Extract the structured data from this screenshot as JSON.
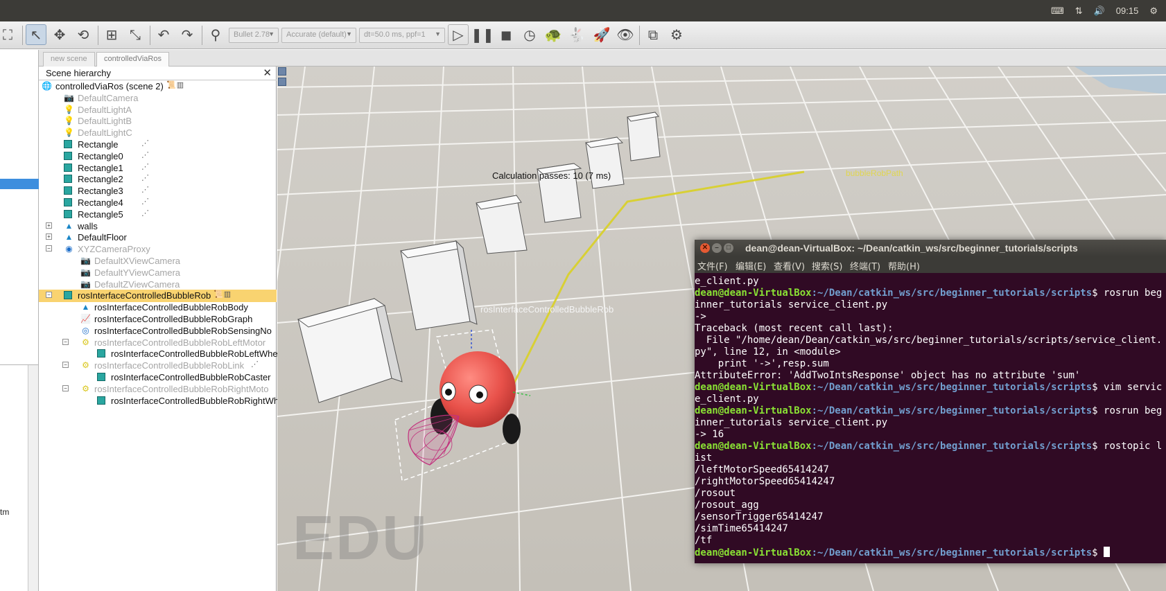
{
  "system_tray": {
    "keyboard_icon": "keyboard-icon",
    "network_icon": "network-arrows-icon",
    "volume_icon": "volume-icon",
    "time": "09:15",
    "gear_icon": "gear-icon"
  },
  "toolbar": {
    "engine": "Bullet 2.78",
    "accuracy": "Accurate (default)",
    "timestep": "dt=50.0 ms, ppf=1"
  },
  "scene_tabs": [
    "new scene",
    "controlledViaRos"
  ],
  "hierarchy": {
    "title": "Scene hierarchy",
    "root": "controlledViaRos (scene 2)",
    "items": [
      {
        "label": "DefaultCamera",
        "icon": "camera-icon",
        "dim": true
      },
      {
        "label": "DefaultLightA",
        "icon": "light-icon",
        "dim": true
      },
      {
        "label": "DefaultLightB",
        "icon": "light-icon",
        "dim": true
      },
      {
        "label": "DefaultLightC",
        "icon": "light-icon",
        "dim": true
      },
      {
        "label": "Rectangle",
        "icon": "cuboid-icon",
        "dim": false
      },
      {
        "label": "Rectangle0",
        "icon": "cuboid-icon",
        "dim": false
      },
      {
        "label": "Rectangle1",
        "icon": "cuboid-icon",
        "dim": false
      },
      {
        "label": "Rectangle2",
        "icon": "cuboid-icon",
        "dim": false
      },
      {
        "label": "Rectangle3",
        "icon": "cuboid-icon",
        "dim": false
      },
      {
        "label": "Rectangle4",
        "icon": "cuboid-icon",
        "dim": false
      },
      {
        "label": "Rectangle5",
        "icon": "cuboid-icon",
        "dim": false
      },
      {
        "label": "walls",
        "icon": "shape-icon",
        "dim": false
      },
      {
        "label": "DefaultFloor",
        "icon": "shape-icon",
        "dim": false
      },
      {
        "label": "XYZCameraProxy",
        "icon": "dummy-icon",
        "dim": true
      },
      {
        "label": "DefaultXViewCamera",
        "icon": "camera-icon",
        "dim": true
      },
      {
        "label": "DefaultYViewCamera",
        "icon": "camera-icon",
        "dim": true
      },
      {
        "label": "DefaultZViewCamera",
        "icon": "camera-icon",
        "dim": true
      },
      {
        "label": "rosInterfaceControlledBubbleRob",
        "icon": "cuboid-icon",
        "dim": false
      },
      {
        "label": "rosInterfaceControlledBubbleRobBody",
        "icon": "shape-icon",
        "dim": false
      },
      {
        "label": "rosInterfaceControlledBubbleRobGraph",
        "icon": "graph-icon",
        "dim": false
      },
      {
        "label": "rosInterfaceControlledBubbleRobSensingNo",
        "icon": "sensor-icon",
        "dim": false
      },
      {
        "label": "rosInterfaceControlledBubbleRobLeftMotor",
        "icon": "joint-icon",
        "dim": true
      },
      {
        "label": "rosInterfaceControlledBubbleRobLeftWhe",
        "icon": "cuboid-icon",
        "dim": false
      },
      {
        "label": "rosInterfaceControlledBubbleRobLink",
        "icon": "joint-icon",
        "dim": true
      },
      {
        "label": "rosInterfaceControlledBubbleRobCaster",
        "icon": "cuboid-icon",
        "dim": false
      },
      {
        "label": "rosInterfaceControlledBubbleRobRightMoto",
        "icon": "joint-icon",
        "dim": true
      },
      {
        "label": "rosInterfaceControlledBubbleRobRightWh",
        "icon": "cuboid-icon",
        "dim": false
      }
    ]
  },
  "left_strip": {
    "label": "tm"
  },
  "viewport": {
    "calc_text": "Calculation passes: 10 (7 ms)",
    "object_label": "rosInterfaceControlledBubbleRob",
    "path_label": "bubbleRobPath",
    "watermark": "EDU"
  },
  "terminal": {
    "title": "dean@dean-VirtualBox: ~/Dean/catkin_ws/src/beginner_tutorials/scripts",
    "menus": [
      "文件(F)",
      "编辑(E)",
      "查看(V)",
      "搜索(S)",
      "终端(T)",
      "帮助(H)"
    ],
    "prompt_user": "dean@dean-VirtualBox",
    "prompt_path": ":~/Dean/catkin_ws/src/beginner_tutorials/scripts",
    "lines": [
      {
        "type": "out",
        "text": "e_client.py"
      },
      {
        "type": "cmd",
        "text": "$ rosrun beg"
      },
      {
        "type": "out",
        "text": "inner_tutorials service_client.py"
      },
      {
        "type": "out",
        "text": "->"
      },
      {
        "type": "out",
        "text": "Traceback (most recent call last):"
      },
      {
        "type": "out",
        "text": "  File \"/home/dean/Dean/catkin_ws/src/beginner_tutorials/scripts/service_client."
      },
      {
        "type": "out",
        "text": "py\", line 12, in <module>"
      },
      {
        "type": "out",
        "text": "    print '->',resp.sum"
      },
      {
        "type": "out",
        "text": "AttributeError: 'AddTwoIntsResponse' object has no attribute 'sum'"
      },
      {
        "type": "cmd",
        "text": "$ vim servic"
      },
      {
        "type": "out",
        "text": "e_client.py"
      },
      {
        "type": "cmd",
        "text": "$ rosrun beg"
      },
      {
        "type": "out",
        "text": "inner_tutorials service_client.py"
      },
      {
        "type": "out",
        "text": "-> 16"
      },
      {
        "type": "cmd",
        "text": "$ rostopic l"
      },
      {
        "type": "out",
        "text": "ist"
      },
      {
        "type": "out",
        "text": "/leftMotorSpeed65414247"
      },
      {
        "type": "out",
        "text": "/rightMotorSpeed65414247"
      },
      {
        "type": "out",
        "text": "/rosout"
      },
      {
        "type": "out",
        "text": "/rosout_agg"
      },
      {
        "type": "out",
        "text": "/sensorTrigger65414247"
      },
      {
        "type": "out",
        "text": "/simTime65414247"
      },
      {
        "type": "out",
        "text": "/tf"
      },
      {
        "type": "cmd",
        "text": "$ "
      }
    ]
  }
}
